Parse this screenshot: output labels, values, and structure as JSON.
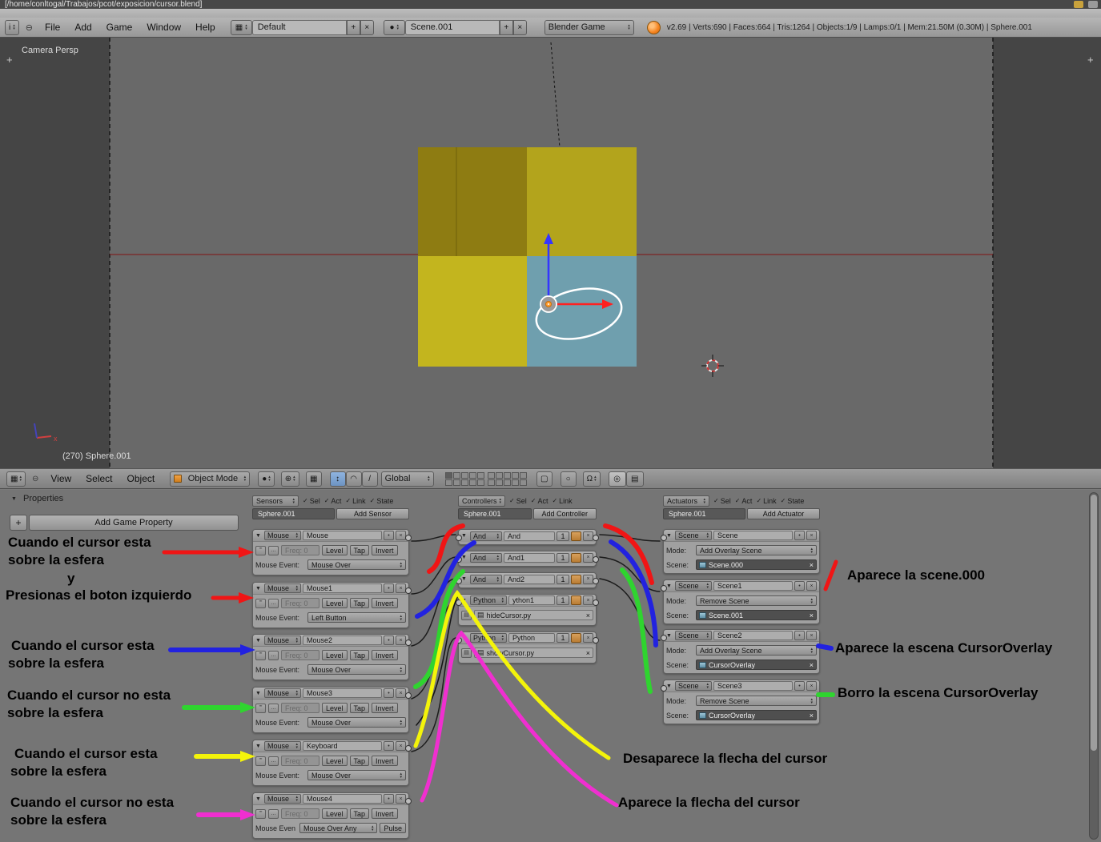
{
  "window": {
    "title": "[/home/conltogal/Trabajos/pcot/exposicion/cursor.blend]"
  },
  "icons": {
    "down": "▼",
    "tiny_up": "▴",
    "tiny_down": "▾",
    "check": "✓",
    "close": "×",
    "plus": "+",
    "pin": "•",
    "pulse_on": "'''",
    "pulse_off": "...",
    "doc": "▤",
    "grid": "▦",
    "info": "i",
    "circle": "●",
    "camera": "◎",
    "magnet": "Ω",
    "snap": "⊕",
    "lock": "▢",
    "slash": "/"
  },
  "info": {
    "menus": [
      "File",
      "Add",
      "Game",
      "Window",
      "Help"
    ],
    "layout_name": "Default",
    "scene_name": "Scene.001",
    "engine": "Blender Game",
    "stats": "v2.69 | Verts:690 | Faces:664 | Tris:1264 | Objects:1/9 | Lamps:0/1 | Mem:21.50M (0.30M) | Sphere.001"
  },
  "viewport": {
    "view_label": "Camera Persp",
    "status_label": "(270) Sphere.001",
    "axis_x_label": "x"
  },
  "view3d_header": {
    "menus": [
      "View",
      "Select",
      "Object"
    ],
    "mode": "Object Mode",
    "orientation": "Global"
  },
  "properties": {
    "title": "Properties",
    "add_game_property": "Add Game Property"
  },
  "logic": {
    "sensors": {
      "title": "Sensors",
      "toggles": [
        "Sel",
        "Act",
        "Link",
        "State"
      ],
      "object": "Sphere.001",
      "add_label": "Add Sensor",
      "labels": {
        "freq": "Freq: 0",
        "level": "Level",
        "tap": "Tap",
        "invert": "Invert"
      },
      "items": [
        {
          "type": "Mouse",
          "name": "Mouse",
          "event_label": "Mouse Event:",
          "event": "Mouse Over"
        },
        {
          "type": "Mouse",
          "name": "Mouse1",
          "event_label": "Mouse Event:",
          "event": "Left Button"
        },
        {
          "type": "Mouse",
          "name": "Mouse2",
          "event_label": "Mouse Event:",
          "event": "Mouse Over"
        },
        {
          "type": "Mouse",
          "name": "Mouse3",
          "event_label": "Mouse Event:",
          "event": "Mouse Over"
        },
        {
          "type": "Mouse",
          "name": "Keyboard",
          "event_label": "Mouse Event:",
          "event": "Mouse Over"
        },
        {
          "type": "Mouse",
          "name": "Mouse4",
          "event_label": "Mouse Even",
          "event": "Mouse Over Any",
          "pulse": "Pulse"
        }
      ]
    },
    "controllers": {
      "title": "Controllers",
      "toggles": [
        "Sel",
        "Act",
        "Link"
      ],
      "object": "Sphere.001",
      "add_label": "Add Controller",
      "items": [
        {
          "type": "And",
          "name": "And",
          "num": "1"
        },
        {
          "type": "And",
          "name": "And1",
          "num": "1"
        },
        {
          "type": "And",
          "name": "And2",
          "num": "1"
        },
        {
          "type": "Python",
          "name": "ython1",
          "num": "1",
          "script": "hideCursor.py"
        },
        {
          "type": "Python",
          "name": "Python",
          "num": "1",
          "script": "showCursor.py"
        }
      ]
    },
    "actuators": {
      "title": "Actuators",
      "toggles": [
        "Sel",
        "Act",
        "Link",
        "State"
      ],
      "object": "Sphere.001",
      "add_label": "Add Actuator",
      "labels": {
        "mode": "Mode:",
        "scene": "Scene:"
      },
      "items": [
        {
          "type": "Scene",
          "name": "Scene",
          "mode": "Add Overlay Scene",
          "scene": "Scene.000"
        },
        {
          "type": "Scene",
          "name": "Scene1",
          "mode": "Remove Scene",
          "scene": "Scene.001"
        },
        {
          "type": "Scene",
          "name": "Scene2",
          "mode": "Add Overlay Scene",
          "scene": "CursorOverlay"
        },
        {
          "type": "Scene",
          "name": "Scene3",
          "mode": "Remove Scene",
          "scene": "CursorOverlay"
        }
      ]
    }
  },
  "annotations": {
    "colors": {
      "red": "#f01515",
      "blue": "#2222e0",
      "green": "#2fd42f",
      "yellow": "#f4f40a",
      "magenta": "#f02fd0",
      "black": "#141414"
    },
    "left": [
      {
        "lines": [
          "Cuando el cursor esta",
          "sobre la esfera",
          "y",
          "Presionas el boton izquierdo"
        ]
      },
      {
        "lines": [
          "Cuando el cursor esta",
          "sobre la esfera"
        ]
      },
      {
        "lines": [
          "Cuando el cursor no esta",
          "sobre la esfera"
        ]
      },
      {
        "lines": [
          "Cuando el cursor esta",
          "sobre la esfera"
        ]
      },
      {
        "lines": [
          "Cuando el cursor no esta",
          "sobre la esfera"
        ]
      }
    ],
    "right": [
      "Aparece la scene.000",
      "Aparece la escena CursorOverlay",
      "Borro la escena CursorOverlay",
      "Desaparece la flecha del cursor",
      "Aparece la flecha del cursor"
    ]
  }
}
